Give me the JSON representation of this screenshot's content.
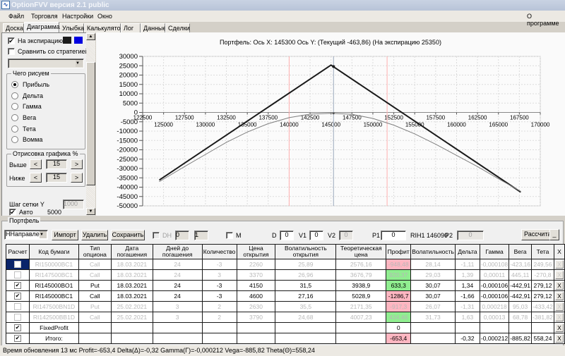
{
  "window": {
    "title": "OptionFVV версия 2.1 public",
    "icon": "app-chart-icon"
  },
  "menu": {
    "items": [
      "Файл",
      "Торговля",
      "Настройки",
      "Окно"
    ],
    "about": "О программе"
  },
  "tabs": [
    "Доска",
    "Диаграмма",
    "Улыбка",
    "Калькулятор",
    "Лог",
    "Данные",
    "Сделки"
  ],
  "active_tab": "Диаграмма",
  "left": {
    "expiration_label": "На экспирацию",
    "expiration_checked": true,
    "swatch_colors": [
      "#1a1a1a",
      "#0000e0"
    ],
    "compare_label": "Сравнить со стратегией",
    "compare_checked": false,
    "strategy_select": "",
    "draw_group": "Чего рисуем",
    "draw_options": [
      "Прибыль",
      "Дельта",
      "Гамма",
      "Вега",
      "Тета",
      "Вомма"
    ],
    "draw_selected": "Прибыль",
    "range_group": "Отрисовка графика %",
    "above_label": "Выше",
    "above_value": "15",
    "below_label": "Ниже",
    "below_value": "15",
    "prev": "<",
    "next": ">",
    "grid_step_label": "Шаг сетки Y",
    "grid_step_value": "1000",
    "auto_label": "Авто",
    "auto_checked": true,
    "auto_value": "5000"
  },
  "chart_data": {
    "type": "line",
    "title": "Портфель: Ось X: 145300 Ось Y:  (Текущий -463,86)  (На экспирацию 25350)",
    "xlim": [
      122500,
      170000
    ],
    "ylim": [
      -50000,
      30000
    ],
    "x_ticks": [
      122500,
      125000,
      127500,
      130000,
      132500,
      135000,
      137500,
      140000,
      142500,
      145000,
      147500,
      150000,
      152500,
      155000,
      157500,
      160000,
      162500,
      165000,
      167500,
      170000
    ],
    "y_ticks": [
      30000,
      25000,
      20000,
      15000,
      10000,
      5000,
      0,
      -5000,
      -10000,
      -15000,
      -20000,
      -25000,
      -30000,
      -35000,
      -40000,
      -45000,
      -50000
    ],
    "grid": true,
    "cursor_x": 145300,
    "markers_x": [
      140000,
      151700
    ],
    "series": [
      {
        "x": [
          124500,
          145000,
          167650
        ],
        "y": [
          -36150,
          25350,
          -42600
        ],
        "color": "#1a1a1a"
      },
      {
        "x": [
          124500,
          127500,
          130000,
          132500,
          135000,
          137500,
          140000,
          142500,
          145000,
          147500,
          150000,
          152500,
          155000,
          157500,
          160000,
          162500,
          165000,
          167650
        ],
        "y": [
          -37000,
          -29000,
          -22500,
          -16000,
          -10500,
          -6000,
          -2800,
          -900,
          -464,
          -1000,
          -3200,
          -6800,
          -11500,
          -17000,
          -23000,
          -29000,
          -35500,
          -42200
        ],
        "color": "#808080"
      }
    ]
  },
  "portfolio": {
    "title": "Портфель",
    "direction_select": "ННаправле",
    "import": "Импорт",
    "delete": "Удалить",
    "save": "Сохранить",
    "dh_label": "DH",
    "spin1": "0",
    "spin2": "1",
    "m_label": "M",
    "d_label": "D",
    "d_value": "0",
    "v1_label": "V1",
    "v1_value": "0",
    "v2_label": "V2",
    "v2_value": "0",
    "p1_label": "P1",
    "p1_value": "0",
    "instrument": "RIH1 146090",
    "p2_label": "P2",
    "p2_value": "0",
    "calculate": "Рассчитать",
    "minimize": "_",
    "columns": [
      "Расчет",
      "Код бумаги",
      "Тип опциона",
      "Дата погашения",
      "Дней до погашения",
      "Количество",
      "Цена открытия",
      "Волатильность открытия",
      "Теоретическая цена",
      "Профит",
      "Волатильность",
      "Дельта",
      "Гамма",
      "Вега",
      "Тета",
      "X"
    ],
    "rows": [
      {
        "checked": false,
        "dim": true,
        "selected": true,
        "cells": [
          "RI150000BC1",
          "Call",
          "18.03.2021",
          "24",
          "-3",
          "2260",
          "25,89",
          "2576,16",
          "-948,48",
          "28,14",
          "-1,11",
          "-0,000108",
          "-423,16",
          "249,56"
        ],
        "profit_color": "pink"
      },
      {
        "checked": false,
        "dim": true,
        "cells": [
          "RI147500BC1",
          "Call",
          "18.03.2021",
          "24",
          "3",
          "3370",
          "26,96",
          "3676,79",
          "920,37",
          "29,03",
          "1,39",
          "0,00011",
          "445,11",
          "-270,8"
        ],
        "profit_color": "green"
      },
      {
        "checked": true,
        "dim": false,
        "cells": [
          "RI145000BO1",
          "Put",
          "18.03.2021",
          "24",
          "-3",
          "4150",
          "31,5",
          "3938,9",
          "633,3",
          "30,07",
          "1,34",
          "-0,000106",
          "-442,91",
          "279,12"
        ],
        "profit_color": "green"
      },
      {
        "checked": true,
        "dim": false,
        "cells": [
          "RI145000BC1",
          "Call",
          "18.03.2021",
          "24",
          "-3",
          "4600",
          "27,16",
          "5028,9",
          "-1286,7",
          "30,07",
          "-1,66",
          "-0,000106",
          "-442,91",
          "279,12"
        ],
        "profit_color": "pink"
      },
      {
        "checked": false,
        "dim": true,
        "cells": [
          "RI147500BN1D",
          "Put",
          "25.02.2021",
          "3",
          "2",
          "2630",
          "35,5",
          "2171,35",
          "-917,3",
          "26,07",
          "-1,31",
          "0,000218",
          "95,03",
          "-433,42"
        ],
        "profit_color": "pink"
      },
      {
        "checked": false,
        "dim": true,
        "cells": [
          "RI142500BB1D",
          "Call",
          "25.02.2021",
          "3",
          "2",
          "3790",
          "24,68",
          "4007,23",
          "434,46",
          "31,73",
          "1,63",
          "0,00013",
          "68,78",
          "-381,82"
        ],
        "profit_color": "green"
      },
      {
        "checked": true,
        "dim": false,
        "cells": [
          "FixedProfit",
          "",
          "",
          "",
          "",
          "",
          "",
          "",
          "0",
          "",
          "",
          "",
          "",
          ""
        ],
        "profit_color": ""
      },
      {
        "checked": true,
        "dim": false,
        "cells": [
          "Итого:",
          "",
          "",
          "",
          "",
          "",
          "",
          "",
          "-653,4",
          "",
          "-0,32",
          "-0,000212",
          "-885,82",
          "558,24"
        ],
        "profit_color": "pink"
      }
    ],
    "delete_glyph": "X"
  },
  "status": "Время обновления 13 мс  Profit=-653,4 Delta(Δ)=-0,32 Gamma(Γ)=-0,000212 Vega=-885,82 Theta(Θ)=558,24",
  "colors": {
    "profit_positive": "#90ee90",
    "profit_negative": "#ffb6c1",
    "selection": "#0a246a"
  }
}
